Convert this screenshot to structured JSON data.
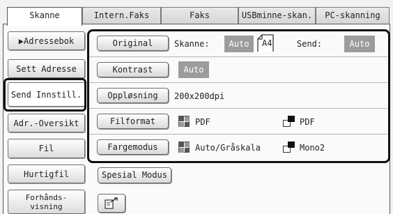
{
  "tabs": [
    {
      "label": "Skanne"
    },
    {
      "label": "Intern.Faks"
    },
    {
      "label": "Faks"
    },
    {
      "label": "USBminne-skan."
    },
    {
      "label": "PC-skanning"
    }
  ],
  "sidebar": {
    "address_book": "▶Adressebok",
    "enter_address": "Sett Adresse",
    "send_settings": "Send Innstill.",
    "address_review": "Adr.-Oversikt",
    "file": "Fil",
    "quick_file": "Hurtigfil",
    "preview_line1": "Forhånds-",
    "preview_line2": "visning"
  },
  "settings": {
    "original": {
      "button": "Original",
      "scan_label": "Skanne:",
      "scan_value": "Auto",
      "paper_size": "A4",
      "send_label": "Send:",
      "send_value": "Auto"
    },
    "contrast": {
      "button": "Kontrast",
      "value": "Auto"
    },
    "resolution": {
      "button": "Oppløsning",
      "value": "200x200dpi"
    },
    "file_format": {
      "button": "Filformat",
      "color_value": "PDF",
      "mono_value": "PDF"
    },
    "color_mode": {
      "button": "Fargemodus",
      "color_value": "Auto/Gråskala",
      "mono_value": "Mono2"
    }
  },
  "special_modes": {
    "button": "Spesial Modus"
  },
  "icons": {
    "paper_corner": "paper-corner-icon",
    "color_mode": "color-quad-icon",
    "mono_mode": "mono-icon",
    "export": "export-arrow-icon"
  },
  "colors": {
    "badge": "#9c9c9c",
    "highlight_border": "#111111"
  }
}
